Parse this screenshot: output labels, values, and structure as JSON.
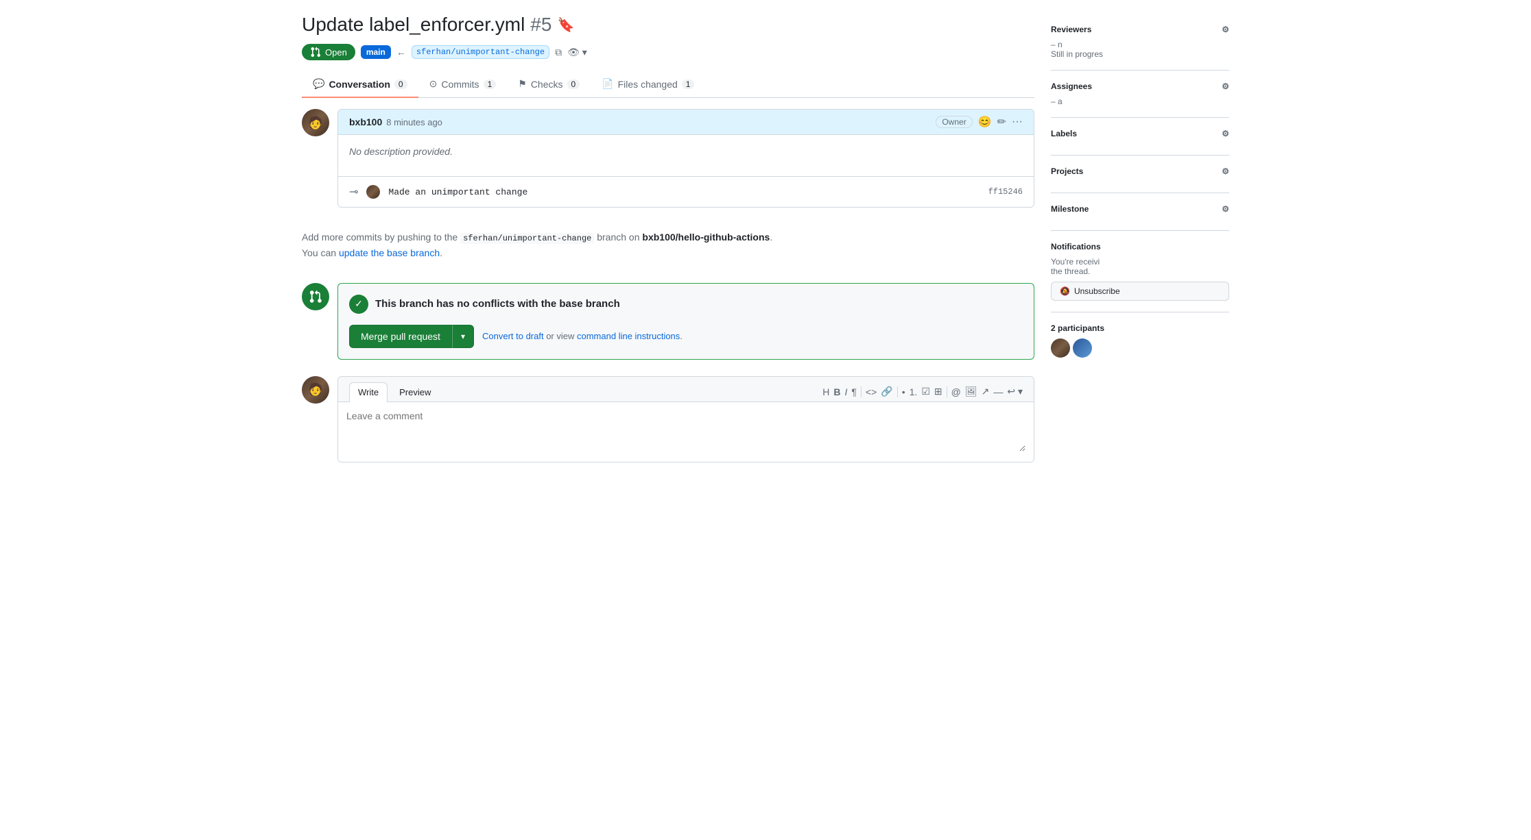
{
  "pr": {
    "title": "Update label_enforcer.yml",
    "number": "#5",
    "bookmark_icon": "🔖",
    "status": "Open",
    "base_branch": "main",
    "head_branch": "sferhan/unimportant-change"
  },
  "tabs": [
    {
      "id": "conversation",
      "label": "Conversation",
      "count": "0",
      "active": true
    },
    {
      "id": "commits",
      "label": "Commits",
      "count": "1",
      "active": false
    },
    {
      "id": "checks",
      "label": "Checks",
      "count": "0",
      "active": false
    },
    {
      "id": "files_changed",
      "label": "Files changed",
      "count": "1",
      "active": false
    }
  ],
  "comment": {
    "author": "bxb100",
    "time": "8 minutes ago",
    "owner_label": "Owner",
    "body": "No description provided.",
    "emoji_icon": "😊",
    "edit_icon": "✏",
    "more_icon": "···"
  },
  "commit": {
    "message": "Made an unimportant change",
    "hash": "ff15246"
  },
  "info": {
    "text_before": "Add more commits by pushing to the ",
    "branch_code": "sferhan/unimportant-change",
    "text_middle": " branch on ",
    "repo_bold": "bxb100/hello-github-actions",
    "text_after": ".",
    "line2_before": "You can ",
    "link_text": "update the base branch",
    "line2_after": "."
  },
  "merge": {
    "status_text": "This branch has no conflicts with the base branch",
    "btn_label": "Merge pull request",
    "convert_link": "Convert to draft",
    "or_text": " or view ",
    "cli_link": "command line instructions",
    "cli_after": "."
  },
  "write_section": {
    "write_tab": "Write",
    "preview_tab": "Preview",
    "placeholder": "Leave a comment",
    "toolbar": [
      "H",
      "B",
      "I",
      "¶",
      "<>",
      "🔗",
      "•",
      "1.",
      "☑",
      "⊞",
      "@",
      "🖼",
      "↗",
      "—",
      "↩"
    ]
  },
  "sidebar": {
    "reviewers_label": "Reviewers",
    "reviewers_dash": "–",
    "reviewers_suffix": "n",
    "reviewers_status": "Still in progres",
    "assignees_label": "Assignees",
    "assignees_dash": "–",
    "assignees_suffix": "a",
    "labels_label": "Labels",
    "projects_label": "Projects",
    "milestone_label": "Milestone",
    "notifications_label": "Notifications",
    "notifications_text": "You're receivi",
    "notifications_text2": "the thread.",
    "participants_label": "2 participants"
  }
}
